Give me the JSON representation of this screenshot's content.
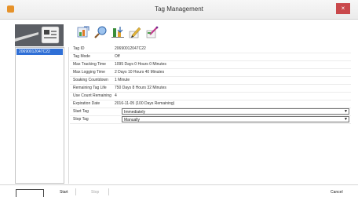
{
  "window": {
    "title": "Tag Management",
    "close_label": "×"
  },
  "toolbar": {
    "icons": [
      "export-icon",
      "search-icon",
      "download-icon",
      "edit-icon",
      "settings-icon"
    ]
  },
  "tag_list": {
    "selected": "20690012047C22"
  },
  "properties": [
    {
      "label": "Tag ID",
      "value": "20690012047C22"
    },
    {
      "label": "Tag Mode",
      "value": "Off"
    },
    {
      "label": "Max Tracking Time",
      "value": "1095 Days 0 Hours 0 Minutes"
    },
    {
      "label": "Max Logging Time",
      "value": "2 Days 10 Hours 40 Minutes"
    },
    {
      "label": "Soaking Countdown",
      "value": "1 Minute"
    },
    {
      "label": "Remaining Tag Life",
      "value": "750 Days 8 Hours 32 Minutes"
    },
    {
      "label": "Use Count Remaining",
      "value": "4"
    },
    {
      "label": "Expiration Date",
      "value": "2016-11-05 (100 Days Remaining)"
    }
  ],
  "start_tag": {
    "label": "Start Tag",
    "value": "Immediately"
  },
  "stop_tag": {
    "label": "Stop Tag",
    "value": "Manually"
  },
  "footer": {
    "start": "Start",
    "stop": "Stop",
    "cancel": "Cancel"
  },
  "colors": {
    "selection": "#2f6fd6",
    "close": "#c9484b"
  }
}
